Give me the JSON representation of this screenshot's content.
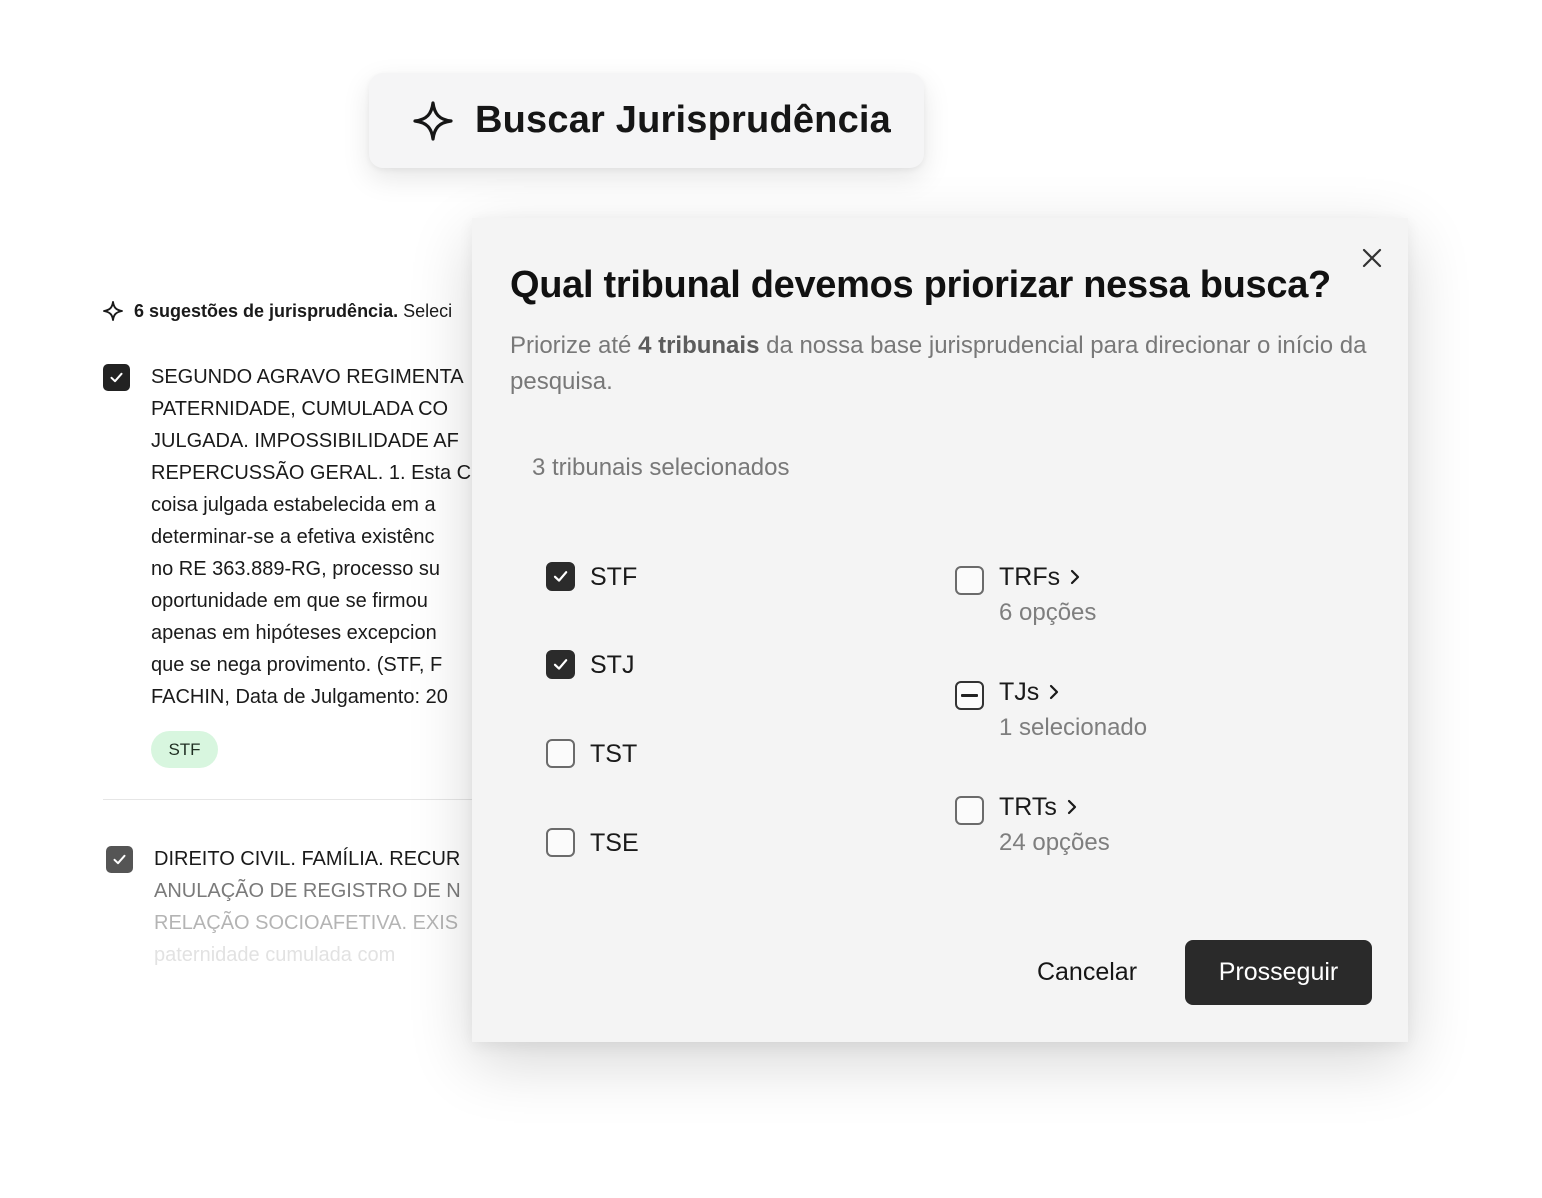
{
  "search": {
    "icon": "sparkle-icon",
    "label": "Buscar Jurisprudência"
  },
  "suggestions": {
    "header_bold": "6 sugestões de jurisprudência.",
    "header_rest": "Seleci",
    "item1": {
      "lines": [
        "SEGUNDO AGRAVO REGIMENTA",
        "PATERNIDADE, CUMULADA CO",
        "JULGADA. IMPOSSIBILIDADE AF",
        "REPERCUSSÃO GERAL. 1. Esta C",
        "coisa julgada estabelecida em a",
        "determinar-se a efetiva existênc",
        "no RE 363.889-RG, processo su",
        "oportunidade em que se firmou",
        "apenas em hipóteses excepcion",
        "que se nega provimento. (STF, F",
        "FACHIN, Data de Julgamento: 20"
      ],
      "tag": "STF"
    },
    "item2": {
      "lines": [
        "DIREITO CIVIL. FAMÍLIA. RECUR",
        "ANULAÇÃO DE REGISTRO DE N",
        "RELAÇÃO SOCIOAFETIVA. EXIS",
        "paternidade cumulada com"
      ]
    }
  },
  "modal": {
    "title": "Qual tribunal devemos priorizar nessa busca?",
    "desc_before": "Priorize até ",
    "desc_bold": "4 tribunais",
    "desc_after": " da nossa base jurisprudencial para direcionar o início da pesquisa.",
    "selected_count": "3 tribunais selecionados",
    "options_left": [
      {
        "name": "STF",
        "checked": true
      },
      {
        "name": "STJ",
        "checked": true
      },
      {
        "name": "TST",
        "checked": false
      },
      {
        "name": "TSE",
        "checked": false
      }
    ],
    "options_right": [
      {
        "name": "TRFs",
        "sub": "6 opções",
        "state": "unchecked"
      },
      {
        "name": "TJs",
        "sub": "1 selecionado",
        "state": "indeterminate"
      },
      {
        "name": "TRTs",
        "sub": "24 opções",
        "state": "unchecked"
      }
    ],
    "cancel_label": "Cancelar",
    "proceed_label": "Prosseguir"
  }
}
